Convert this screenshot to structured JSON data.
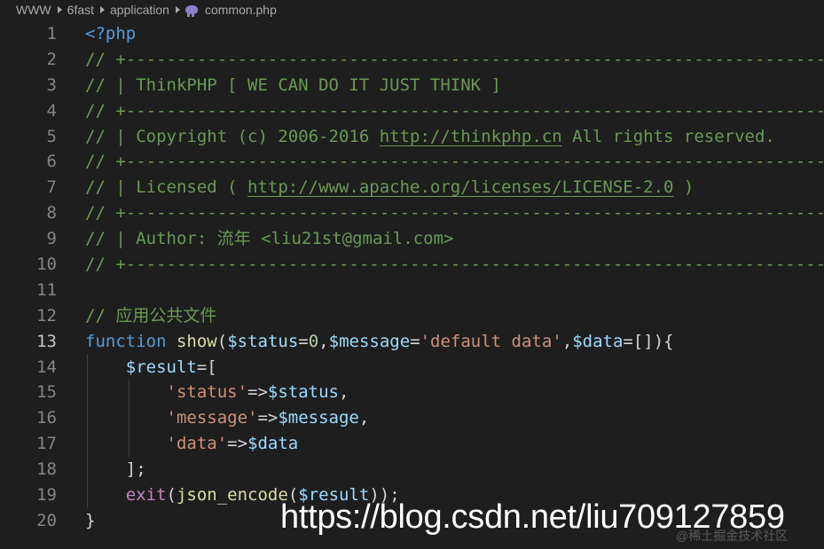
{
  "breadcrumb": {
    "items": [
      "WWW",
      "6fast",
      "application"
    ],
    "file_icon": "php-elephant-icon",
    "file": "common.php"
  },
  "editor": {
    "active_line": 13,
    "lines": [
      {
        "n": "1",
        "segments": [
          {
            "t": "tag",
            "v": "<?php"
          }
        ]
      },
      {
        "n": "2",
        "segments": [
          {
            "t": "comment",
            "v": "// +----------------------------------------------------------------------"
          }
        ]
      },
      {
        "n": "3",
        "segments": [
          {
            "t": "comment",
            "v": "// | ThinkPHP [ WE CAN DO IT JUST THINK ]"
          }
        ]
      },
      {
        "n": "4",
        "segments": [
          {
            "t": "comment",
            "v": "// +----------------------------------------------------------------------"
          }
        ]
      },
      {
        "n": "5",
        "segments": [
          {
            "t": "comment",
            "v": "// | Copyright (c) 2006-2016 "
          },
          {
            "t": "link",
            "v": "http://thinkphp.cn"
          },
          {
            "t": "comment",
            "v": " All rights reserved."
          }
        ]
      },
      {
        "n": "6",
        "segments": [
          {
            "t": "comment",
            "v": "// +----------------------------------------------------------------------"
          }
        ]
      },
      {
        "n": "7",
        "segments": [
          {
            "t": "comment",
            "v": "// | Licensed ( "
          },
          {
            "t": "link",
            "v": "http://www.apache.org/licenses/LICENSE-2.0"
          },
          {
            "t": "comment",
            "v": " )"
          }
        ]
      },
      {
        "n": "8",
        "segments": [
          {
            "t": "comment",
            "v": "// +----------------------------------------------------------------------"
          }
        ]
      },
      {
        "n": "9",
        "segments": [
          {
            "t": "comment",
            "v": "// | Author: 流年 <liu21st@gmail.com>"
          }
        ]
      },
      {
        "n": "10",
        "segments": [
          {
            "t": "comment",
            "v": "// +----------------------------------------------------------------------"
          }
        ]
      },
      {
        "n": "11",
        "segments": []
      },
      {
        "n": "12",
        "segments": [
          {
            "t": "comment",
            "v": "// 应用公共文件"
          }
        ]
      },
      {
        "n": "13",
        "segments": [
          {
            "t": "keyword",
            "v": "function"
          },
          {
            "t": "punc",
            "v": " "
          },
          {
            "t": "func",
            "v": "show"
          },
          {
            "t": "punc",
            "v": "("
          },
          {
            "t": "var",
            "v": "$status"
          },
          {
            "t": "punc",
            "v": "="
          },
          {
            "t": "num",
            "v": "0"
          },
          {
            "t": "punc",
            "v": ","
          },
          {
            "t": "var",
            "v": "$message"
          },
          {
            "t": "punc",
            "v": "="
          },
          {
            "t": "str",
            "v": "'default data'"
          },
          {
            "t": "punc",
            "v": ","
          },
          {
            "t": "var",
            "v": "$data"
          },
          {
            "t": "punc",
            "v": "=[]){"
          }
        ]
      },
      {
        "n": "14",
        "guides": 1,
        "segments": [
          {
            "t": "punc",
            "v": "    "
          },
          {
            "t": "var",
            "v": "$result"
          },
          {
            "t": "punc",
            "v": "=["
          }
        ]
      },
      {
        "n": "15",
        "guides": 2,
        "segments": [
          {
            "t": "punc",
            "v": "        "
          },
          {
            "t": "str",
            "v": "'status'"
          },
          {
            "t": "punc",
            "v": "=>"
          },
          {
            "t": "var",
            "v": "$status"
          },
          {
            "t": "punc",
            "v": ","
          }
        ]
      },
      {
        "n": "16",
        "guides": 2,
        "segments": [
          {
            "t": "punc",
            "v": "        "
          },
          {
            "t": "str",
            "v": "'message'"
          },
          {
            "t": "punc",
            "v": "=>"
          },
          {
            "t": "var",
            "v": "$message"
          },
          {
            "t": "punc",
            "v": ","
          }
        ]
      },
      {
        "n": "17",
        "guides": 2,
        "segments": [
          {
            "t": "punc",
            "v": "        "
          },
          {
            "t": "str",
            "v": "'data'"
          },
          {
            "t": "punc",
            "v": "=>"
          },
          {
            "t": "var",
            "v": "$data"
          }
        ]
      },
      {
        "n": "18",
        "guides": 1,
        "segments": [
          {
            "t": "punc",
            "v": "    ];"
          }
        ]
      },
      {
        "n": "19",
        "guides": 1,
        "segments": [
          {
            "t": "punc",
            "v": "    "
          },
          {
            "t": "exit",
            "v": "exit"
          },
          {
            "t": "punc",
            "v": "("
          },
          {
            "t": "func",
            "v": "json_encode"
          },
          {
            "t": "punc",
            "v": "("
          },
          {
            "t": "var",
            "v": "$result"
          },
          {
            "t": "punc",
            "v": "));"
          }
        ]
      },
      {
        "n": "20",
        "segments": [
          {
            "t": "punc",
            "v": "}"
          }
        ]
      }
    ]
  },
  "watermark": {
    "url": "https://blog.csdn.net/liu709127859",
    "secondary": "@稀土掘金技术社区"
  }
}
